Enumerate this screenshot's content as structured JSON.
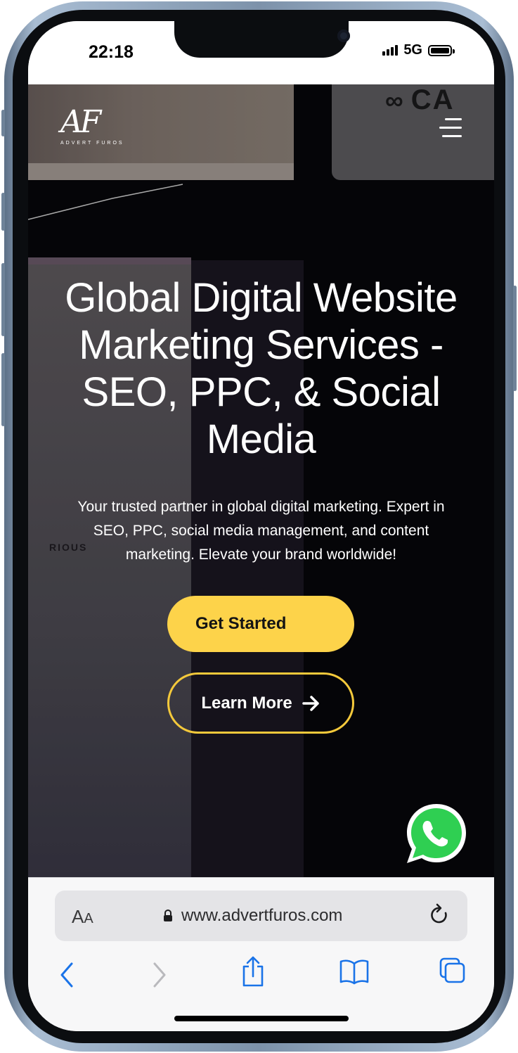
{
  "status_bar": {
    "time": "22:18",
    "network": "5G"
  },
  "site": {
    "logo_mark": "AF",
    "logo_tagline": "ADVERT FUROS",
    "bg_logo_text": "CA",
    "bg_text": "RIOUS",
    "hero": {
      "title": "Global Digital Website Marketing Services - SEO, PPC, & Social Media",
      "subtitle": "Your trusted partner in global digital marketing. Expert in SEO, PPC, social media management, and content marketing. Elevate your brand worldwide!",
      "primary_button": "Get Started",
      "secondary_button": "Learn More"
    },
    "accent_color": "#fdd34a"
  },
  "browser": {
    "aa_label_a": "A",
    "aa_label_b": "A",
    "url": "www.advertfuros.com",
    "icons": [
      "lock-icon",
      "reload-icon",
      "back-icon",
      "forward-icon",
      "share-icon",
      "bookmarks-icon",
      "tabs-icon"
    ]
  },
  "floating": {
    "icon": "whatsapp-icon"
  }
}
